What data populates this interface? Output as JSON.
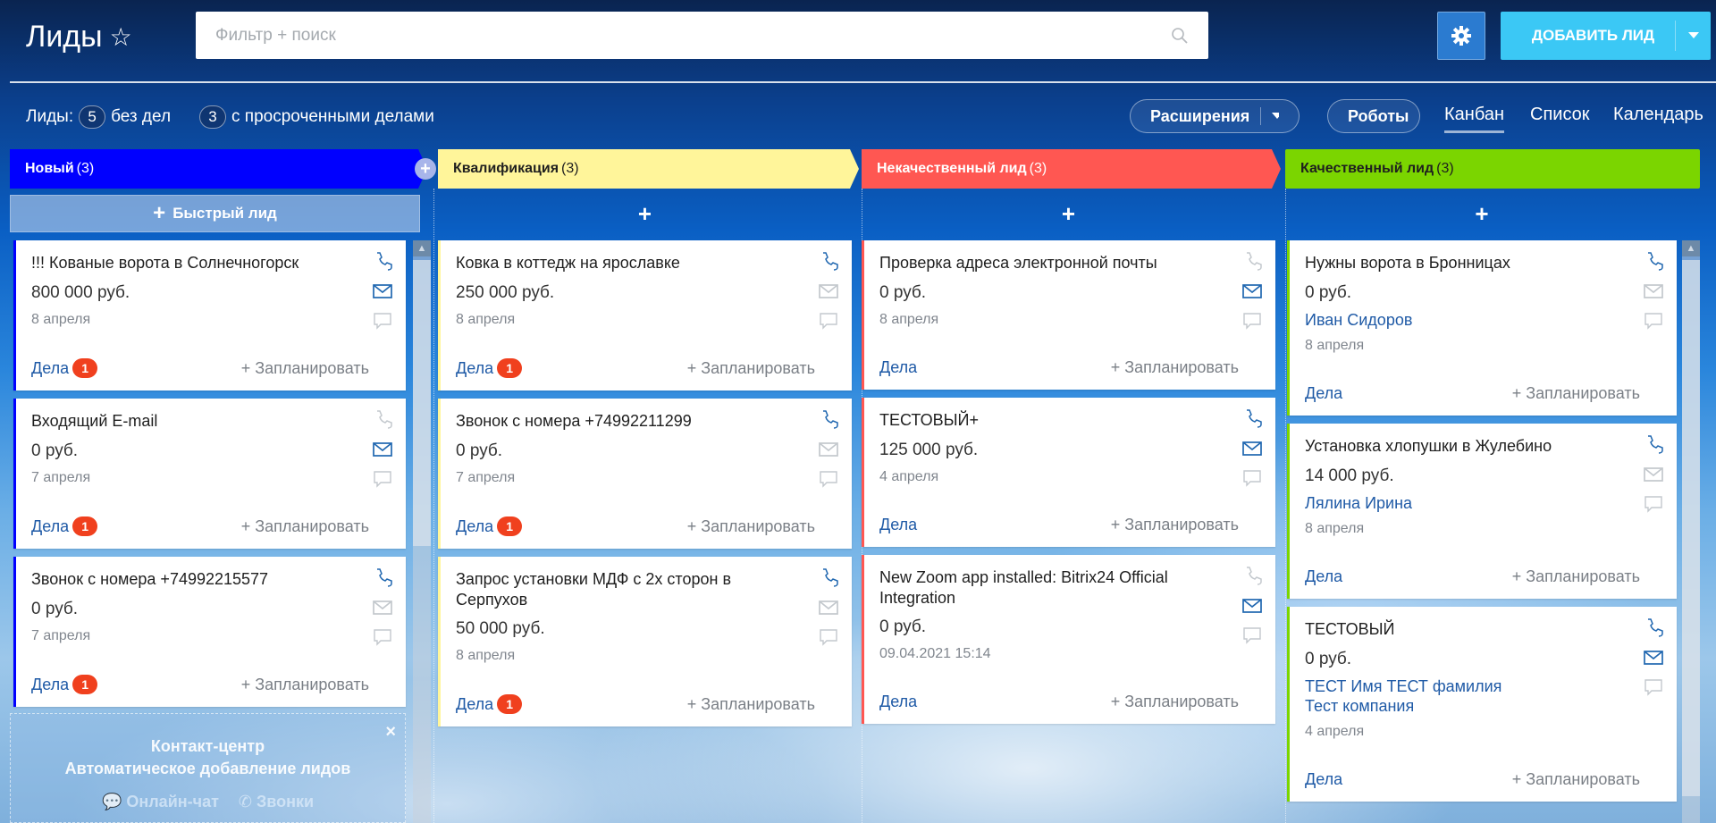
{
  "header": {
    "title": "Лиды",
    "search_placeholder": "Фильтр + поиск",
    "add_label": "ДОБАВИТЬ ЛИД"
  },
  "counters": {
    "label": "Лиды:",
    "no_tasks_count": "5",
    "no_tasks_label": "без дел",
    "overdue_count": "3",
    "overdue_label": "с просроченными делами"
  },
  "toolbar": {
    "extensions": "Расширения",
    "robots": "Роботы",
    "views": [
      "Канбан",
      "Список",
      "Календарь"
    ],
    "active_view": "Канбан"
  },
  "quick_lead": "Быстрый лид",
  "plus": "+",
  "colors": {
    "accent_blue": "#1f5aa6",
    "badge": "#f0401e",
    "icon_active": "#2067b0",
    "icon_inactive": "#c3c8cd"
  },
  "columns": [
    {
      "title": "Новый",
      "count": "(3)",
      "color": "#0000ff",
      "text": "#ffffff",
      "cards": [
        {
          "title": "!!! Кованые ворота в Солнечногорск",
          "price": "800 000 руб.",
          "date": "8 апреля",
          "phone": true,
          "mail": true,
          "tasks": "Дела",
          "badge": "1",
          "plan": "+ Запланировать"
        },
        {
          "title": "Входящий E-mail",
          "price": "0 руб.",
          "date": "7 апреля",
          "phone": false,
          "mail": true,
          "tasks": "Дела",
          "badge": "1",
          "plan": "+ Запланировать"
        },
        {
          "title": "Звонок с номера +74992215577",
          "price": "0 руб.",
          "date": "7 апреля",
          "phone": true,
          "mail": false,
          "tasks": "Дела",
          "badge": "1",
          "plan": "+ Запланировать"
        }
      ]
    },
    {
      "title": "Квалификация",
      "count": "(3)",
      "color": "#fff59a",
      "text": "#1f1f1f",
      "cards": [
        {
          "title": "Ковка в коттедж на ярославке",
          "price": "250 000 руб.",
          "date": "8 апреля",
          "phone": true,
          "mail": false,
          "tasks": "Дела",
          "badge": "1",
          "plan": "+ Запланировать"
        },
        {
          "title": "Звонок с номера +74992211299",
          "price": "0 руб.",
          "date": "7 апреля",
          "phone": true,
          "mail": false,
          "tasks": "Дела",
          "badge": "1",
          "plan": "+ Запланировать"
        },
        {
          "title": "Запрос установки МДФ с 2х сторон в Серпухов",
          "price": "50 000 руб.",
          "date": "8 апреля",
          "phone": true,
          "mail": false,
          "tasks": "Дела",
          "badge": "1",
          "plan": "+ Запланировать"
        }
      ]
    },
    {
      "title": "Некачественный лид",
      "count": "(3)",
      "color": "#ff5752",
      "text": "#ffffff",
      "cards": [
        {
          "title": "Проверка адреса электронной почты",
          "price": "0 руб.",
          "date": "8 апреля",
          "phone": false,
          "mail": true,
          "tasks": "Дела",
          "plan": "+ Запланировать"
        },
        {
          "title": "ТЕСТОВЫЙ+",
          "price": "125 000 руб.",
          "date": "4 апреля",
          "phone": true,
          "mail": true,
          "tasks": "Дела",
          "plan": "+ Запланировать"
        },
        {
          "title": "New Zoom app installed: Bitrix24 Official Integration",
          "price": "0 руб.",
          "date": "09.04.2021 15:14",
          "phone": false,
          "mail": true,
          "tasks": "Дела",
          "plan": "+ Запланировать"
        }
      ]
    },
    {
      "title": "Качественный лид",
      "count": "(3)",
      "color": "#7bd500",
      "text": "#1f1f1f",
      "cards": [
        {
          "title": "Нужны ворота в Бронницах",
          "price": "0 руб.",
          "contacts": [
            "Иван Сидоров"
          ],
          "date": "8 апреля",
          "phone": true,
          "mail": false,
          "tasks": "Дела",
          "plan": "+ Запланировать"
        },
        {
          "title": "Установка хлопушки в Жулебино",
          "price": "14 000 руб.",
          "contacts": [
            "Лялина Ирина"
          ],
          "date": "8 апреля",
          "phone": true,
          "mail": false,
          "tasks": "Дела",
          "plan": "+ Запланировать"
        },
        {
          "title": "ТЕСТОВЫЙ",
          "price": "0 руб.",
          "contacts": [
            "ТЕСТ Имя ТЕСТ фамилия",
            "Тест компания"
          ],
          "date": "4 апреля",
          "phone": true,
          "mail": true,
          "tasks": "Дела",
          "plan": "+ Запланировать"
        }
      ]
    }
  ],
  "contact_center": {
    "title": "Контакт-центр",
    "subtitle": "Автоматическое добавление лидов",
    "chat": "Онлайн-чат",
    "calls": "Звонки",
    "close": "×"
  }
}
